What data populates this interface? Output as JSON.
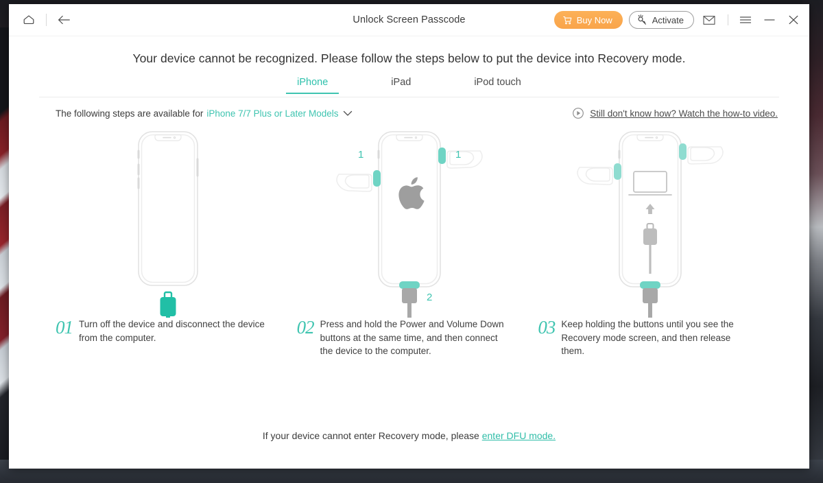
{
  "window": {
    "title": "Unlock Screen Passcode",
    "home_icon": "home-icon",
    "back_icon": "back-arrow-icon",
    "buy_now_label": "Buy Now",
    "buy_now_icon": "cart-icon",
    "activate_label": "Activate",
    "activate_icon": "key-icon",
    "mail_icon": "envelope-icon",
    "menu_icon": "hamburger-menu-icon",
    "minimize_icon": "minimize-icon",
    "close_icon": "close-icon",
    "accent_color": "#3fc4b0",
    "buy_now_color": "#f9a44a"
  },
  "main": {
    "headline": "Your device cannot be recognized. Please follow the steps below to put the device into Recovery mode.",
    "tabs": [
      {
        "label": "iPhone",
        "active": true
      },
      {
        "label": "iPad",
        "active": false
      },
      {
        "label": "iPod touch",
        "active": false
      }
    ],
    "subbar": {
      "prefix": "The following steps are available for",
      "model": "iPhone 7/7 Plus or Later Models",
      "chevron_icon": "chevron-down-icon",
      "video_icon": "play-circle-icon",
      "video_label": "Still don't know how? Watch the how-to video."
    },
    "steps": [
      {
        "number": "01",
        "text": "Turn off the device and disconnect the device from the computer.",
        "art": "iphone-outline-with-detached-cable"
      },
      {
        "number": "02",
        "text": "Press and hold the Power and Volume Down buttons at the same time, and then connect the device to the computer.",
        "art": "iphone-apple-logo-hands-pressing-buttons",
        "badge_left": "1",
        "badge_right": "1",
        "badge_bottom": "2"
      },
      {
        "number": "03",
        "text": "Keep holding the buttons until you see the Recovery mode screen, and then release them.",
        "art": "iphone-recovery-mode-screen-with-cable"
      }
    ],
    "footer": {
      "text": "If your device cannot enter Recovery mode, please",
      "link": "enter DFU mode."
    }
  }
}
